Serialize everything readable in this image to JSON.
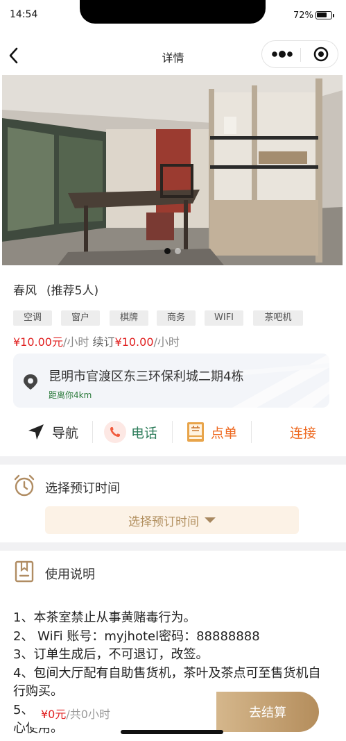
{
  "status_bar": {
    "time": "14:54",
    "battery_text": "72%",
    "battery_level": 0.72
  },
  "nav": {
    "title": "详情"
  },
  "banner": {
    "slide_count": 2,
    "active_slide": 1
  },
  "room": {
    "name": "春风",
    "recommend": "(推荐5人)",
    "tags": [
      "空调",
      "窗户",
      "棋牌",
      "商务",
      "WIFI",
      "茶吧机"
    ],
    "price": "¥10.00元",
    "price_unit": "/小时",
    "renew_label": "续订",
    "renew_price": "¥10.00",
    "renew_unit": "/小时"
  },
  "address": {
    "text": "昆明市官渡区东三环保利城二期4栋",
    "distance": "距离你4km"
  },
  "actions": {
    "navigate": "导航",
    "phone": "电话",
    "order": "点单",
    "connect": "连接"
  },
  "booking": {
    "title": "选择预订时间",
    "picker": "选择预订时间"
  },
  "usage": {
    "title": "使用说明",
    "lines": [
      "1、本茶室禁止从事黄赌毒行为。",
      "2、 WiFi 账号：myjhotel密码：88888888",
      "3、订单生成后，不可退订，改签。",
      "4、包间大厅配有自助售货机，茶叶及茶点可至售货机自行购买。",
      "5、",
      "心使用。"
    ]
  },
  "bottom": {
    "price": "¥0元",
    "duration": "/共0小时",
    "checkout": "去结算"
  },
  "colors": {
    "accent_orange": "#ee6a22",
    "price_red": "#e02020",
    "checkout_gold": "#c6a272",
    "distance_green": "#2b7a3b"
  }
}
